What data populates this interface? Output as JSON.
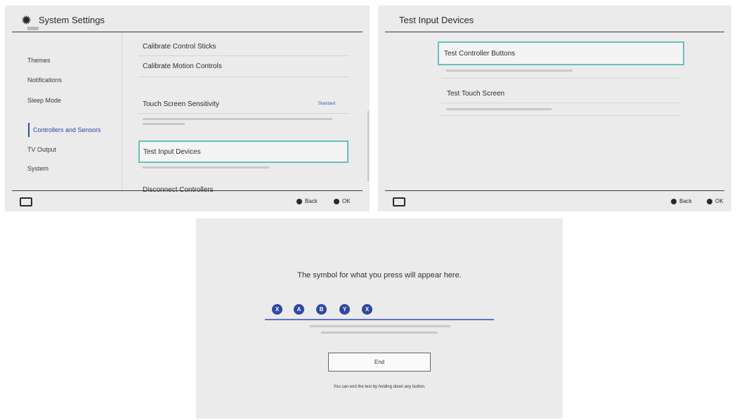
{
  "screen1": {
    "title": "System Settings",
    "sidebar": [
      {
        "label": "Themes"
      },
      {
        "label": "Notifications"
      },
      {
        "label": "Sleep Mode"
      },
      {
        "label": "Controllers and Sensors",
        "selected": true
      },
      {
        "label": "TV Output"
      },
      {
        "label": "System"
      }
    ],
    "items": {
      "calibrate_sticks": "Calibrate Control Sticks",
      "calibrate_motion": "Calibrate Motion Controls",
      "touch_sensitivity": "Touch Screen Sensitivity",
      "touch_sensitivity_value": "Standard",
      "test_input": "Test Input Devices",
      "disconnect": "Disconnect Controllers"
    },
    "footer": {
      "back": "Back",
      "ok": "OK"
    }
  },
  "screen2": {
    "title": "Test Input Devices",
    "items": {
      "buttons": "Test Controller Buttons",
      "touch": "Test Touch Screen"
    },
    "footer": {
      "back": "Back",
      "ok": "OK"
    }
  },
  "screen3": {
    "prompt": "The symbol for what you press will appear here.",
    "symbols": [
      "X",
      "A",
      "B",
      "Y",
      "X"
    ],
    "end_button": "End",
    "hold_text": "You can end the test by holding down any button."
  },
  "colors": {
    "accent_blue": "#2f47a4",
    "selection_teal": "#67c0bb",
    "panel_bg": "#ebebeb"
  }
}
